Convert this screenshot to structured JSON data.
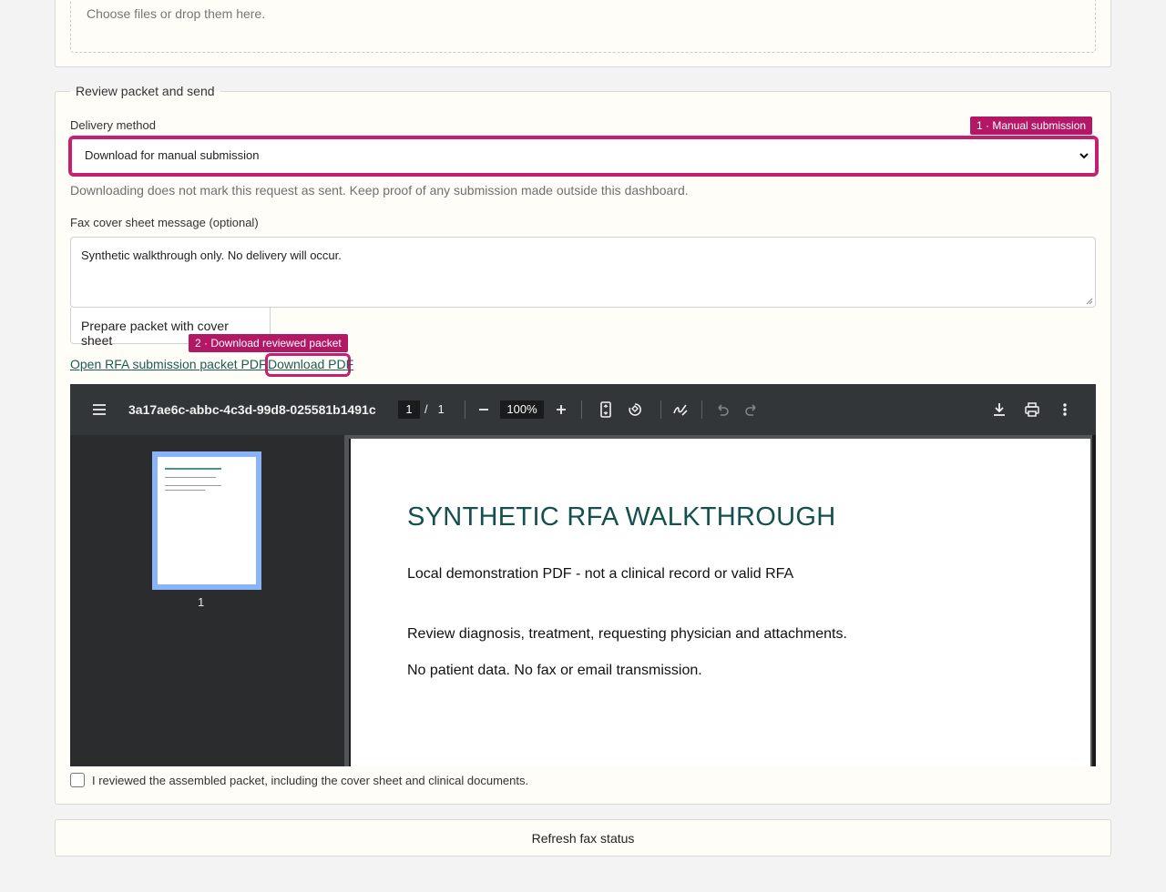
{
  "upload": {
    "dropzone_text": "Choose files or drop them here."
  },
  "review": {
    "legend": "Review packet and send",
    "delivery_label": "Delivery method",
    "delivery_badge": "1 · Manual submission",
    "delivery_value": "Download for manual submission",
    "delivery_hint": "Downloading does not mark this request as sent. Keep proof of any submission made outside this dashboard.",
    "cover_label": "Fax cover sheet message (optional)",
    "cover_value": "Synthetic walkthrough only. No delivery will occur.",
    "prepare_button": "Prepare packet with cover sheet",
    "download_badge": "2 · Download reviewed packet",
    "open_link": "Open RFA submission packet PDF",
    "download_link": "Download PDF",
    "reviewed_checkbox_label": "I reviewed the assembled packet, including the cover sheet and clinical documents.",
    "reviewed_checked": false
  },
  "viewer": {
    "doc_title": "3a17ae6c-abbc-4c3d-99d8-025581b1491c",
    "current_page": "1",
    "page_sep": "/",
    "total_pages": "1",
    "zoom": "100%",
    "thumb_label": "1",
    "page": {
      "title": "SYNTHETIC RFA WALKTHROUGH",
      "line1": "Local demonstration PDF - not a clinical record or valid RFA",
      "line2": "Review diagnosis, treatment, requesting physician and attachments.",
      "line3": "No patient data. No fax or email transmission."
    },
    "icons": {
      "menu": "menu-icon",
      "zoom_out": "minus-icon",
      "zoom_in": "plus-icon",
      "fit": "fit-page-icon",
      "rotate": "rotate-icon",
      "annotate": "annotate-icon",
      "undo": "undo-icon",
      "redo": "redo-icon",
      "download": "download-icon",
      "print": "print-icon",
      "more": "more-vert-icon"
    }
  },
  "refresh_button": "Refresh fax status",
  "colors": {
    "accent": "#b31867",
    "link": "#1d5b54",
    "pdf_title": "#14504d",
    "toolbar": "#323639",
    "thumb_highlight": "#8ab4f8"
  }
}
